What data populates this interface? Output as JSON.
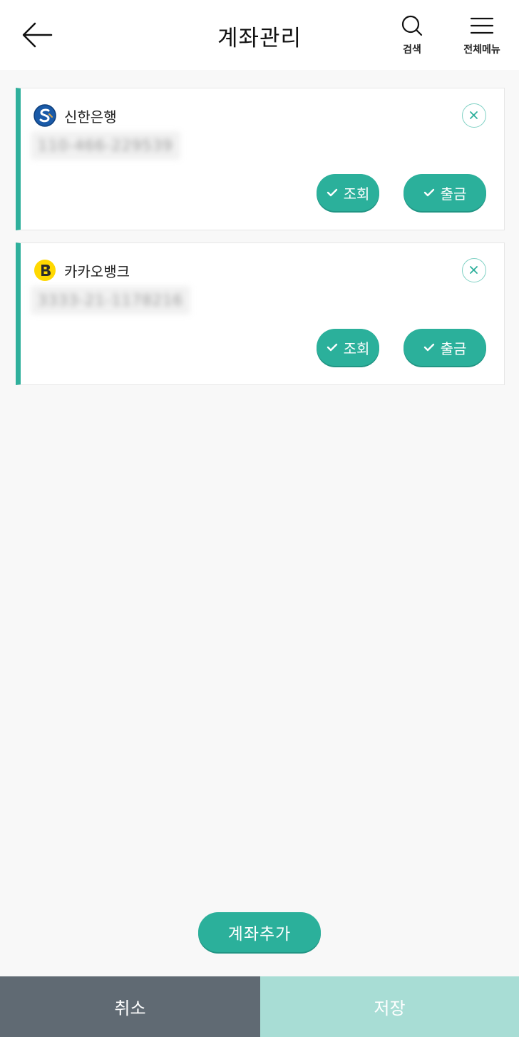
{
  "header": {
    "title": "계좌관리",
    "search_label": "검색",
    "menu_label": "전체메뉴"
  },
  "accounts": [
    {
      "bank_name": "신한은행",
      "account_number": "110-466-229539",
      "view_label": "조회",
      "withdraw_label": "출금",
      "logo_icon": "shinhan-logo"
    },
    {
      "bank_name": "카카오뱅크",
      "account_number": "3333-21-1178216",
      "view_label": "조회",
      "withdraw_label": "출금",
      "logo_icon": "kakaobank-logo"
    }
  ],
  "add_account_label": "계좌추가",
  "footer": {
    "cancel_label": "취소",
    "save_label": "저장"
  },
  "colors": {
    "accent": "#2bb09b",
    "accent_light": "#a8ddd5",
    "cancel_bg": "#606a73",
    "background": "#f8f8f8"
  }
}
